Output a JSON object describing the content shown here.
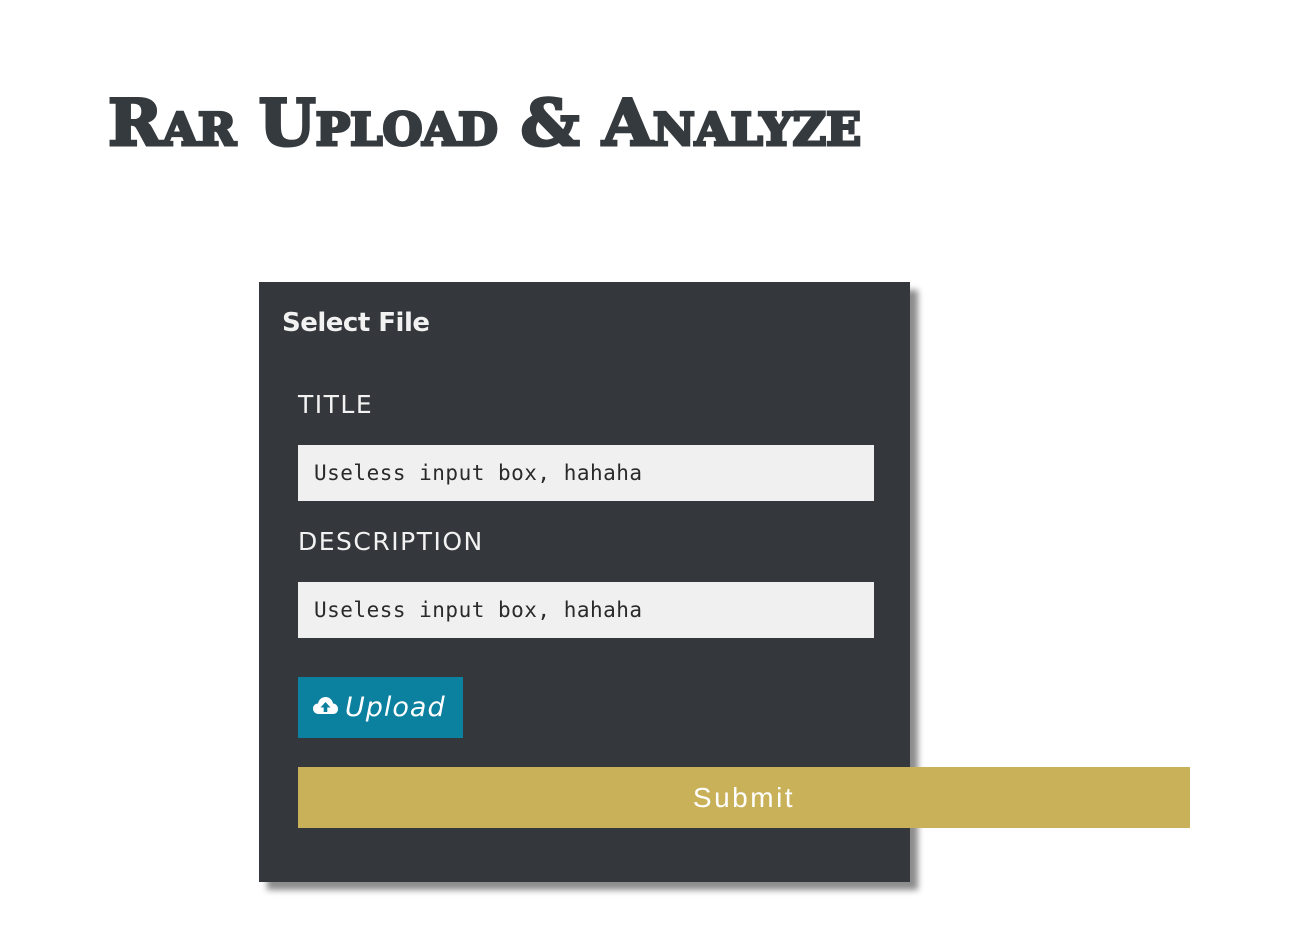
{
  "page": {
    "title": "Rar Upload & Analyze"
  },
  "form": {
    "heading": "Select File",
    "title_label": "TITLE",
    "title_placeholder": "Useless input box, hahaha",
    "description_label": "DESCRIPTION",
    "description_placeholder": "Useless input box, hahaha",
    "upload_label": "Upload",
    "upload_icon": "cloud-upload-icon",
    "submit_label": "Submit"
  },
  "colors": {
    "panel": "#34373b",
    "upload_button": "#0b809f",
    "submit_button": "#c9b15a",
    "title_text": "#353a3e"
  }
}
